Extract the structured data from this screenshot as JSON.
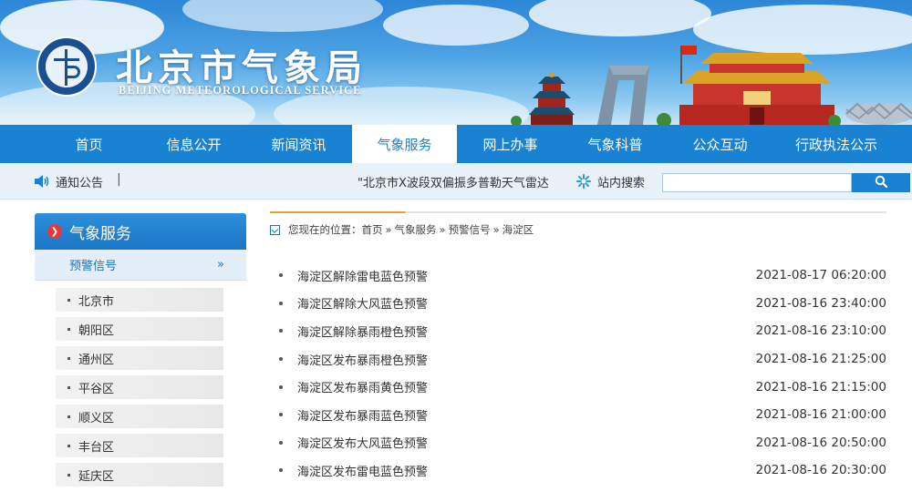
{
  "header": {
    "title": "北京市气象局",
    "subtitle": "BEIJING METEOROLOGICAL SERVICE",
    "seal_text": "BEIJING METEOROLOGICAL SERVICE 北京市气象局"
  },
  "nav": {
    "items": [
      {
        "label": "首页"
      },
      {
        "label": "信息公开"
      },
      {
        "label": "新闻资讯"
      },
      {
        "label": "气象服务"
      },
      {
        "label": "网上办事"
      },
      {
        "label": "气象科普"
      },
      {
        "label": "公众互动"
      },
      {
        "label": "行政执法公示"
      }
    ],
    "active_label": "气象服务"
  },
  "notice": {
    "label": "通知公告",
    "separator": "|",
    "ticker_text": "\"北京市X波段双偏振多普勒天气雷达"
  },
  "search": {
    "label": "站内搜索",
    "placeholder": "",
    "button_icon": "search-icon"
  },
  "sidebar": {
    "title": "气象服务",
    "current": {
      "label": "预警信号",
      "chevron": "»"
    },
    "items": [
      {
        "label": "北京市"
      },
      {
        "label": "朝阳区"
      },
      {
        "label": "通州区"
      },
      {
        "label": "平谷区"
      },
      {
        "label": "顺义区"
      },
      {
        "label": "丰台区"
      },
      {
        "label": "延庆区"
      }
    ]
  },
  "breadcrumb": {
    "prefix": "您现在的位置：",
    "items": [
      "首页",
      "气象服务",
      "预警信号",
      "海淀区"
    ],
    "separator": "»"
  },
  "list": {
    "rows": [
      {
        "title": "海淀区解除雷电蓝色预警",
        "time": "2021-08-17 06:20:00"
      },
      {
        "title": "海淀区解除大风蓝色预警",
        "time": "2021-08-16 23:40:00"
      },
      {
        "title": "海淀区解除暴雨橙色预警",
        "time": "2021-08-16 23:10:00"
      },
      {
        "title": "海淀区发布暴雨橙色预警",
        "time": "2021-08-16 21:25:00"
      },
      {
        "title": "海淀区发布暴雨黄色预警",
        "time": "2021-08-16 21:15:00"
      },
      {
        "title": "海淀区发布暴雨蓝色预警",
        "time": "2021-08-16 21:00:00"
      },
      {
        "title": "海淀区发布大风蓝色预警",
        "time": "2021-08-16 20:50:00"
      },
      {
        "title": "海淀区发布雷电蓝色预警",
        "time": "2021-08-16 20:30:00"
      }
    ]
  },
  "colors": {
    "primary": "#1a82d2",
    "accent_orange": "#f29b38",
    "notice_bg": "#e9f1f9"
  }
}
